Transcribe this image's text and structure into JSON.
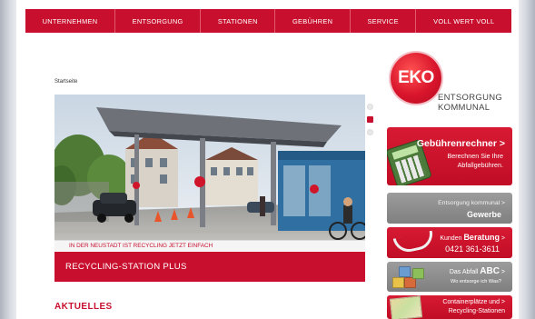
{
  "nav": {
    "items": [
      "UNTERNEHMEN",
      "ENTSORGUNG",
      "STATIONEN",
      "GEBÜHREN",
      "SERVICE",
      "VOLL WERT VOLL"
    ]
  },
  "breadcrumb": "Startseite",
  "slider": {
    "caption": "IN DER NEUSTADT IST RECYCLING JETZT EINFACH",
    "title": "RECYCLING-STATION PLUS",
    "slide_count": 3,
    "active_index": 1
  },
  "section_heading": "AKTUELLES",
  "logo": {
    "mark": "EKO",
    "line1": "ENTSORGUNG",
    "line2": "KOMMUNAL"
  },
  "side_boxes": {
    "gebuehren": {
      "title": "Gebührenrechner >",
      "line1": "Berechnen Sie Ihre",
      "line2": "Abfallgebühren."
    },
    "gewerbe": {
      "line1": "Entsorgung kommunal >",
      "line2": "Gewerbe"
    },
    "beratung": {
      "prefix": "Kunden ",
      "bold": "Beratung",
      "suffix": " >",
      "phone": "0421 361-3611"
    },
    "abc": {
      "prefix": "Das Abfall ",
      "bold": "ABC",
      "suffix": " >",
      "line2": "Wo entsorge ich Was?"
    },
    "container": {
      "line1": "Containerplätze und >",
      "line2": "Recycling-Stationen"
    }
  },
  "colors": {
    "brand_red": "#c8102e",
    "gray_box": "#8c8c8c"
  }
}
